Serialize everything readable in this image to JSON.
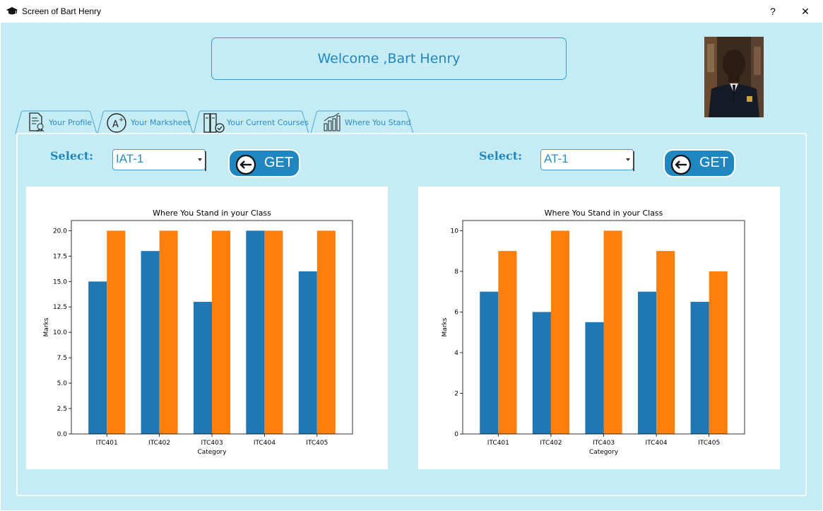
{
  "window": {
    "title": "Screen of Bart Henry",
    "help_label": "?",
    "close_label": "✕"
  },
  "welcome": {
    "text": "Welcome ,Bart Henry"
  },
  "tabs": [
    {
      "label": "Your Profile",
      "icon": "profile-document-icon"
    },
    {
      "label": "Your Marksheet",
      "icon": "grade-a-plus-icon"
    },
    {
      "label": "Your Current Courses",
      "icon": "books-icon"
    },
    {
      "label": "Where You Stand",
      "icon": "bar-chart-icon"
    }
  ],
  "left": {
    "select_label": "Select:",
    "select_value": "IAT-1",
    "get_label": "GET"
  },
  "right": {
    "select_label": "Select:",
    "select_value": "AT-1",
    "get_label": "GET"
  },
  "colors": {
    "series1": "#1f77b4",
    "series2": "#ff7f0e",
    "accent": "#1f86c0",
    "background": "#c5ecf5"
  },
  "chart_data": [
    {
      "type": "bar",
      "title": "Where You Stand in your Class",
      "xlabel": "Category",
      "ylabel": "Marks",
      "categories": [
        "ITC401",
        "ITC402",
        "ITC403",
        "ITC404",
        "ITC405"
      ],
      "series": [
        {
          "values": [
            15,
            18,
            13,
            20,
            16
          ]
        },
        {
          "values": [
            20,
            20,
            20,
            20,
            20
          ]
        }
      ],
      "ylim": [
        0,
        21
      ],
      "yticks": [
        "0.0",
        "2.5",
        "5.0",
        "7.5",
        "10.0",
        "12.5",
        "15.0",
        "17.5",
        "20.0"
      ],
      "ytick_values": [
        0,
        2.5,
        5,
        7.5,
        10,
        12.5,
        15,
        17.5,
        20
      ]
    },
    {
      "type": "bar",
      "title": "Where You Stand in your Class",
      "xlabel": "Category",
      "ylabel": "Marks",
      "categories": [
        "ITC401",
        "ITC402",
        "ITC403",
        "ITC404",
        "ITC405"
      ],
      "series": [
        {
          "values": [
            7,
            6,
            5.5,
            7,
            6.5
          ]
        },
        {
          "values": [
            9,
            10,
            10,
            9,
            8
          ]
        }
      ],
      "ylim": [
        0,
        10.5
      ],
      "yticks": [
        "0",
        "2",
        "4",
        "6",
        "8",
        "10"
      ],
      "ytick_values": [
        0,
        2,
        4,
        6,
        8,
        10
      ]
    }
  ]
}
